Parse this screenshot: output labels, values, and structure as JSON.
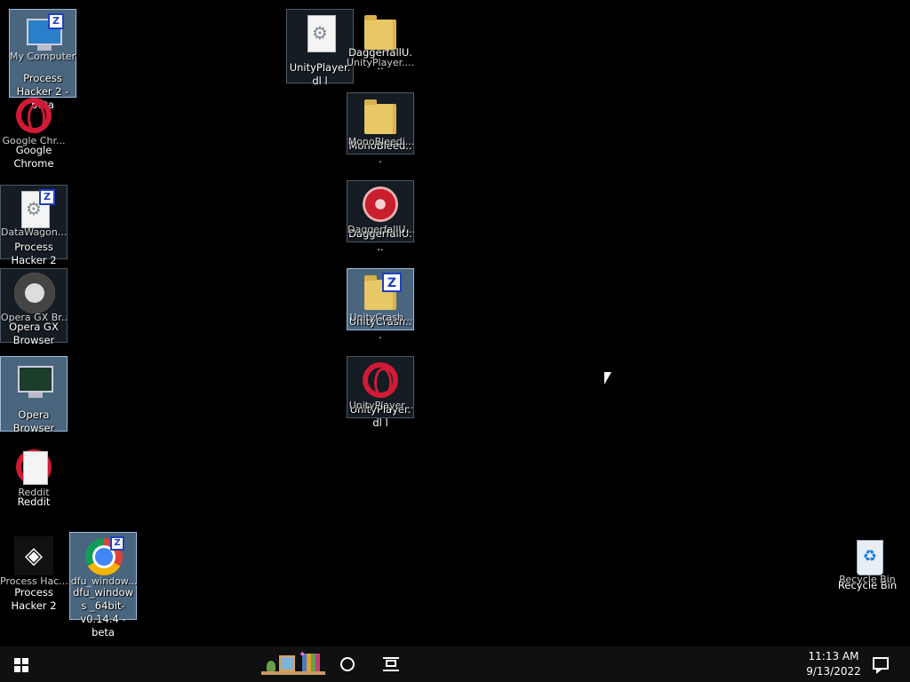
{
  "desktop": {
    "icons": [
      {
        "label": "Process Hacker 2 -beta",
        "ghost": "My Computer / UnityPlayer.d"
      },
      {
        "label": "Google Chrome",
        "ghost": "Google Chr..."
      },
      {
        "label": "Process Hacker 2",
        "ghost": "DataWagon...  d..."
      },
      {
        "label": "Opera GX Browser",
        "ghost": "Opera GX Br..."
      },
      {
        "label": "Opera Browser",
        "ghost": ""
      },
      {
        "label": "Reddit",
        "ghost": "Reddit"
      },
      {
        "label": "Process Hacker 2",
        "ghost": "Process Hac..."
      },
      {
        "label": "dfu_windows _64bit-v0.14.4 -beta",
        "ghost": "dfu_window..."
      },
      {
        "label": "UnityPlayer.dl l",
        "ghost": ""
      },
      {
        "label": "DaggerfallU...",
        "ghost": "UnityPlayer...."
      },
      {
        "label": "MonoBleed...",
        "ghost": "MonoBleedi..."
      },
      {
        "label": "DaggerfallU...",
        "ghost": "DaggerfallU..."
      },
      {
        "label": "UnityCrash...",
        "ghost": "UnityCrash..."
      },
      {
        "label": "UnityPlayer.dl l",
        "ghost": "UnityPlayer..."
      },
      {
        "label": "Recycle Bin",
        "ghost": "Recycle Bin"
      }
    ]
  },
  "taskbar": {
    "time": "11:13 AM",
    "date": "9/13/2022"
  },
  "icons": {
    "start": "windows-logo-icon",
    "search": "cortana-circle-icon",
    "taskview": "task-view-icon",
    "notifications": "action-center-icon"
  }
}
